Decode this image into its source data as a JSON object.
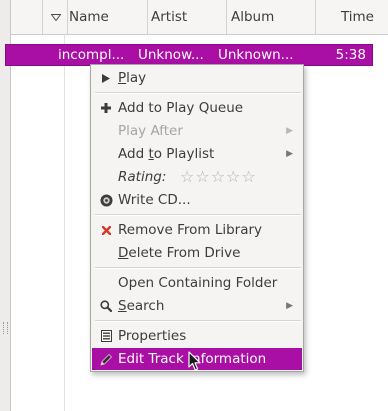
{
  "header": {
    "name": "Name",
    "artist": "Artist",
    "album": "Album",
    "time": "Time"
  },
  "selected_track": {
    "name": "incompl...",
    "artist": "Unknow...",
    "album": "Unknown...",
    "time": "5:38"
  },
  "menu": {
    "play": {
      "pre": "",
      "mnemonic": "P",
      "post": "lay"
    },
    "add_queue": {
      "pre": "Add to Play Queue",
      "mnemonic": "",
      "post": ""
    },
    "play_after": "Play After",
    "add_playlist": {
      "pre": "Add ",
      "mnemonic": "t",
      "post": "o Playlist"
    },
    "rating": "Rating:",
    "rating_value": "☆☆☆☆☆",
    "write_cd": "Write CD...",
    "remove": "Remove From Library",
    "delete": {
      "pre": "",
      "mnemonic": "D",
      "post": "elete From Drive"
    },
    "open_folder": "Open Containing Folder",
    "search": {
      "pre": "",
      "mnemonic": "S",
      "post": "earch"
    },
    "properties": "Properties",
    "edit_info": "Edit Track Information"
  },
  "colors": {
    "selection": "#aa0fa5",
    "remove_icon": "#d63a2a"
  },
  "icons": {
    "play": "play-icon",
    "add": "plus-icon",
    "cd": "cd-icon",
    "remove": "x-icon",
    "search": "magnifier-icon",
    "properties": "properties-icon",
    "edit": "pencil-icon",
    "submenu": "chevron-right-icon",
    "sort": "sort-down-icon",
    "cursor": "pointer-cursor"
  }
}
